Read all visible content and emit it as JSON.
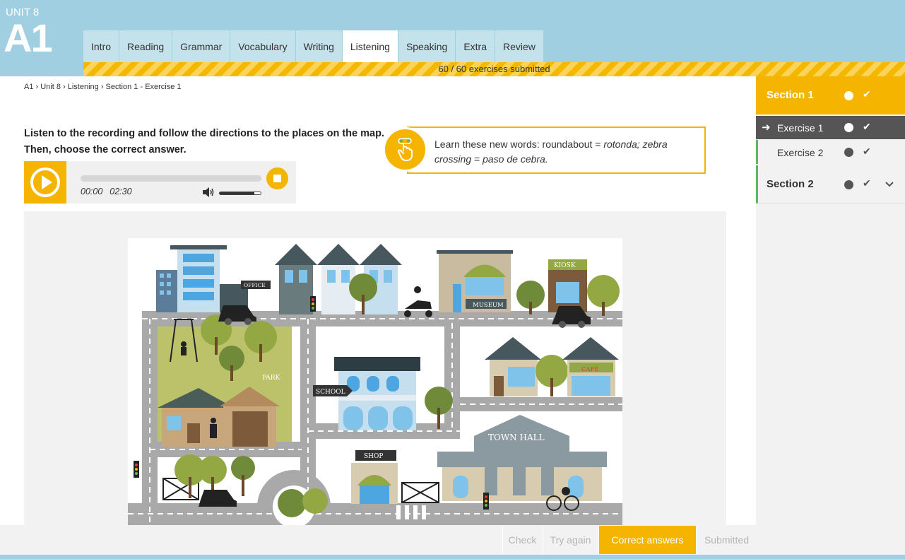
{
  "header": {
    "unit_label": "UNIT 8",
    "level": "A1",
    "tabs": [
      {
        "label": "Intro"
      },
      {
        "label": "Reading"
      },
      {
        "label": "Grammar"
      },
      {
        "label": "Vocabulary"
      },
      {
        "label": "Writing"
      },
      {
        "label": "Listening",
        "active": true
      },
      {
        "label": "Speaking"
      },
      {
        "label": "Extra"
      },
      {
        "label": "Review"
      }
    ],
    "progress_text": "60 / 60 exercises submitted"
  },
  "breadcrumb": "A1 › Unit 8 › Listening › Section 1 - Exercise 1",
  "instructions": "Listen to the recording and follow the directions to the places on the map. Then, choose the correct answer.",
  "player": {
    "current_time": "00:00",
    "duration": "02:30",
    "volume": 0.85
  },
  "tip": {
    "prefix": "Learn these new words: roundabout = ",
    "term1": "rotonda; zebra crossing",
    "middle": " = ",
    "term2": "paso de cebra."
  },
  "map": {
    "labels": {
      "office": "OFFICE",
      "kiosk": "KIOSK",
      "museum": "MUSEUM",
      "park": "PARK",
      "school": "SCHOOL",
      "cafe": "CAFÉ",
      "town_hall": "TOWN HALL",
      "shop": "SHOP"
    }
  },
  "actions": {
    "check": "Check",
    "try_again": "Try again",
    "correct_answers": "Correct answers",
    "submitted": "Submitted"
  },
  "sidebar": {
    "section1": "Section 1",
    "exercise1": "Exercise 1",
    "exercise2": "Exercise 2",
    "section2": "Section 2"
  },
  "colors": {
    "accent": "#f5b400",
    "header": "#9fcfe0",
    "complete": "#5cb85c"
  }
}
